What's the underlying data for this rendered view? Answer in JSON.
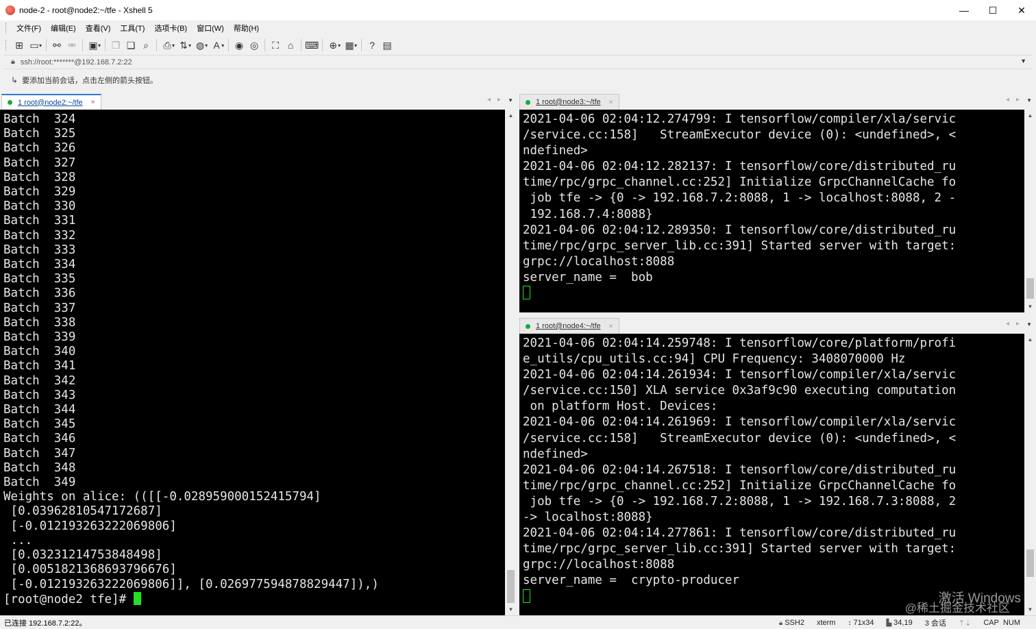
{
  "window": {
    "title": "node-2 - root@node2:~/tfe - Xshell 5",
    "minimize": "—",
    "maximize": "☐",
    "close": "✕"
  },
  "menu": [
    "文件(F)",
    "编辑(E)",
    "查看(V)",
    "工具(T)",
    "选项卡(B)",
    "窗口(W)",
    "帮助(H)"
  ],
  "toolbar_icons": [
    "new-session-icon",
    "open-folder-icon",
    "reconnect-icon",
    "disconnect-icon",
    "properties-icon",
    "copy-icon",
    "paste-icon",
    "find-icon",
    "print-icon",
    "transfer-icon",
    "globe-icon",
    "font-icon",
    "xftp-icon",
    "xmanager-icon",
    "fullscreen-icon",
    "lock-icon",
    "keyboard-icon",
    "add-tab-icon",
    "layout-icon",
    "help-icon",
    "chat-icon"
  ],
  "address": {
    "text": "ssh://root:*******@192.168.7.2:22"
  },
  "hint": {
    "text": "要添加当前会话，点击左侧的箭头按钮。"
  },
  "left_pane": {
    "tab_label": "1 root@node2:~/tfe",
    "tab_close": "×",
    "lines": [
      "Batch  324",
      "Batch  325",
      "Batch  326",
      "Batch  327",
      "Batch  328",
      "Batch  329",
      "Batch  330",
      "Batch  331",
      "Batch  332",
      "Batch  333",
      "Batch  334",
      "Batch  335",
      "Batch  336",
      "Batch  337",
      "Batch  338",
      "Batch  339",
      "Batch  340",
      "Batch  341",
      "Batch  342",
      "Batch  343",
      "Batch  344",
      "Batch  345",
      "Batch  346",
      "Batch  347",
      "Batch  348",
      "Batch  349",
      "Weights on alice: (([[-0.028959000152415794]",
      " [0.03962810547172687]",
      " [-0.012193263222069806]",
      " ...",
      " [0.03231214753848498]",
      " [0.0051821368693796676]",
      " [-0.012193263222069806]], [0.026977594878829447]),)"
    ],
    "prompt": "[root@node2 tfe]# "
  },
  "right_top_pane": {
    "tab_label": "1 root@node3:~/tfe",
    "tab_close": "×",
    "lines": [
      "2021-04-06 02:04:12.274799: I tensorflow/compiler/xla/servic",
      "/service.cc:158]   StreamExecutor device (0): <undefined>, <",
      "ndefined>",
      "2021-04-06 02:04:12.282137: I tensorflow/core/distributed_ru",
      "time/rpc/grpc_channel.cc:252] Initialize GrpcChannelCache fo",
      " job tfe -> {0 -> 192.168.7.2:8088, 1 -> localhost:8088, 2 -",
      " 192.168.7.4:8088}",
      "2021-04-06 02:04:12.289350: I tensorflow/core/distributed_ru",
      "time/rpc/grpc_server_lib.cc:391] Started server with target:",
      "grpc://localhost:8088",
      "server_name =  bob"
    ]
  },
  "right_bottom_pane": {
    "tab_label": "1 root@node4:~/tfe",
    "tab_close": "×",
    "lines": [
      "2021-04-06 02:04:14.259748: I tensorflow/core/platform/profi",
      "e_utils/cpu_utils.cc:94] CPU Frequency: 3408070000 Hz",
      "2021-04-06 02:04:14.261934: I tensorflow/compiler/xla/servic",
      "/service.cc:150] XLA service 0x3af9c90 executing computation",
      " on platform Host. Devices:",
      "2021-04-06 02:04:14.261969: I tensorflow/compiler/xla/servic",
      "/service.cc:158]   StreamExecutor device (0): <undefined>, <",
      "ndefined>",
      "2021-04-06 02:04:14.267518: I tensorflow/core/distributed_ru",
      "time/rpc/grpc_channel.cc:252] Initialize GrpcChannelCache fo",
      " job tfe -> {0 -> 192.168.7.2:8088, 1 -> 192.168.7.3:8088, 2",
      "-> localhost:8088}",
      "2021-04-06 02:04:14.277861: I tensorflow/core/distributed_ru",
      "time/rpc/grpc_server_lib.cc:391] Started server with target:",
      "grpc://localhost:8088",
      "server_name =  crypto-producer"
    ]
  },
  "status": {
    "connection": "已连接 192.168.7.2:22。",
    "protocol": "SSH2",
    "terminal": "xterm",
    "size": "71x34",
    "cursor": "34,19",
    "sessions": "3 会话",
    "caps": "CAP",
    "num": "NUM"
  },
  "watermark": {
    "line1": "激活 Windows",
    "line2": "@稀土掘金技术社区"
  },
  "colors": {
    "terminal_bg": "#000000",
    "terminal_fg": "#e6e6e6",
    "cursor": "#22e022",
    "tab_active": "#2b7bd6",
    "tab_dot": "#1aaa3a"
  }
}
